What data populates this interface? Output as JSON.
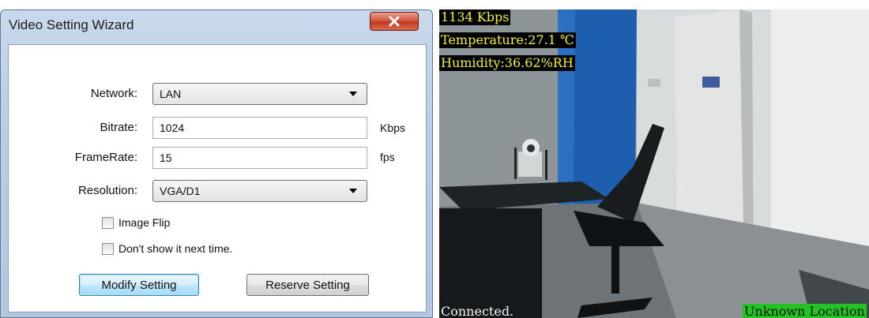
{
  "dialog": {
    "title": "Video Setting Wizard",
    "fields": {
      "network": {
        "label": "Network:",
        "value": "LAN"
      },
      "bitrate": {
        "label": "Bitrate:",
        "value": "1024",
        "unit": "Kbps"
      },
      "framerate": {
        "label": "FrameRate:",
        "value": "15",
        "unit": "fps"
      },
      "resolution": {
        "label": "Resolution:",
        "value": "VGA/D1"
      }
    },
    "checkboxes": {
      "image_flip": {
        "label": "Image Flip",
        "checked": false
      },
      "dont_show": {
        "label": "Don't show it next time.",
        "checked": false
      }
    },
    "buttons": {
      "modify": "Modify Setting",
      "reserve": "Reserve Setting"
    }
  },
  "camera": {
    "bitrate_overlay": "1134 Kbps",
    "temperature_overlay": "Temperature:27.1 ℃",
    "humidity_overlay": "Humidity:36.62%RH",
    "status": "Connected.",
    "location": "Unknown Location"
  }
}
